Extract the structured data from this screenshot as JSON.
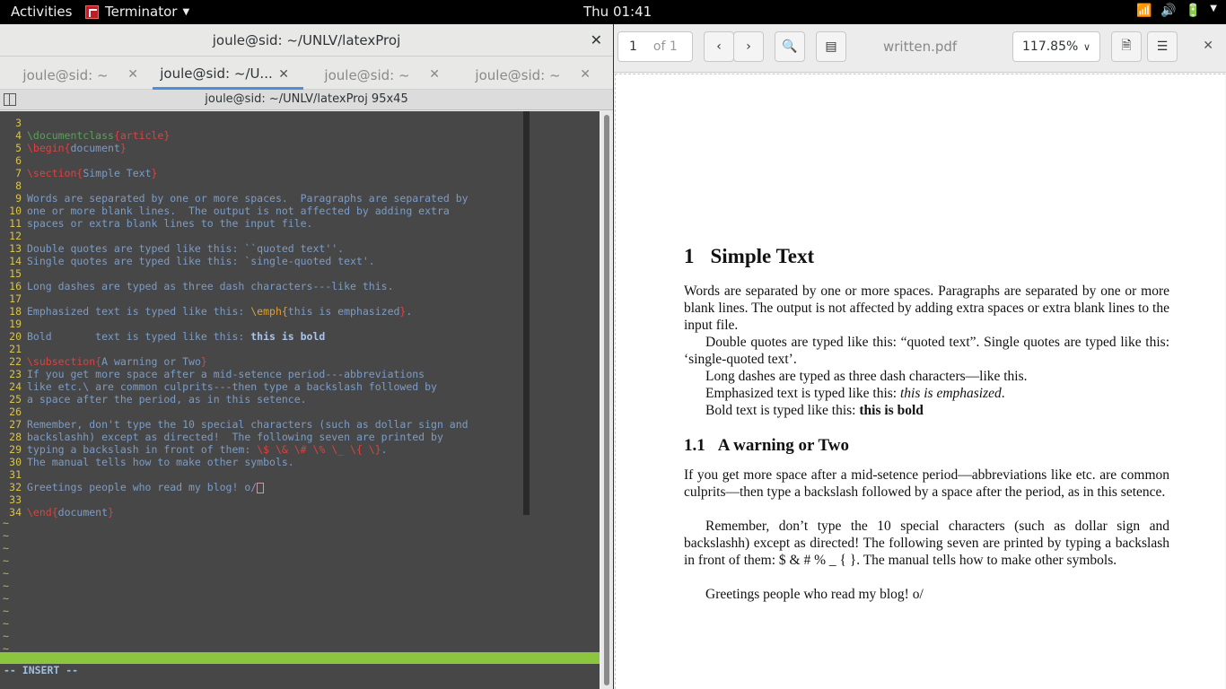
{
  "topbar": {
    "activities": "Activities",
    "app_name": "Terminator",
    "clock": "Thu 01:41",
    "icons": [
      "wifi-icon",
      "volume-icon",
      "battery-icon",
      "system-menu-caret"
    ]
  },
  "terminal": {
    "window_title": "joule@sid: ~/UNLV/latexProj",
    "tabs": [
      {
        "label": "joule@sid: ~",
        "active": false
      },
      {
        "label": "joule@sid: ~/U...",
        "active": true
      },
      {
        "label": "joule@sid: ~",
        "active": false
      },
      {
        "label": "joule@sid: ~",
        "active": false
      }
    ],
    "infobar": "joule@sid: ~/UNLV/latexProj 95x45",
    "vim_lines": [
      {
        "n": "3",
        "t": ""
      },
      {
        "n": "4",
        "t": "\\documentclass{article}"
      },
      {
        "n": "5",
        "t": "\\begin{document}"
      },
      {
        "n": "6",
        "t": ""
      },
      {
        "n": "7",
        "t": "\\section{Simple Text}"
      },
      {
        "n": "8",
        "t": ""
      },
      {
        "n": "9",
        "t": "Words are separated by one or more spaces.  Paragraphs are separated by"
      },
      {
        "n": "10",
        "t": "one or more blank lines.  The output is not affected by adding extra"
      },
      {
        "n": "11",
        "t": "spaces or extra blank lines to the input file."
      },
      {
        "n": "12",
        "t": ""
      },
      {
        "n": "13",
        "t": "Double quotes are typed like this: ``quoted text''."
      },
      {
        "n": "14",
        "t": "Single quotes are typed like this: `single-quoted text'."
      },
      {
        "n": "15",
        "t": ""
      },
      {
        "n": "16",
        "t": "Long dashes are typed as three dash characters---like this."
      },
      {
        "n": "17",
        "t": ""
      },
      {
        "n": "18",
        "t": "Emphasized text is typed like this: \\emph{this is emphasized}."
      },
      {
        "n": "19",
        "t": ""
      },
      {
        "n": "20",
        "t": "Bold       text is typed like this: this is bold"
      },
      {
        "n": "21",
        "t": ""
      },
      {
        "n": "22",
        "t": "\\subsection{A warning or Two}"
      },
      {
        "n": "23",
        "t": "If you get more space after a mid-setence period---abbreviations"
      },
      {
        "n": "24",
        "t": "like etc.\\ are common culprits---then type a backslash followed by"
      },
      {
        "n": "25",
        "t": "a space after the period, as in this setence."
      },
      {
        "n": "26",
        "t": ""
      },
      {
        "n": "27",
        "t": "Remember, don't type the 10 special characters (such as dollar sign and"
      },
      {
        "n": "28",
        "t": "backslashh) except as directed!  The following seven are printed by"
      },
      {
        "n": "29",
        "t": "typing a backslash in front of them: \\$ \\& \\# \\% \\_ \\{ \\}."
      },
      {
        "n": "30",
        "t": "The manual tells how to make other symbols."
      },
      {
        "n": "31",
        "t": ""
      },
      {
        "n": "32",
        "t": "Greetings people who read my blog! o/"
      },
      {
        "n": "33",
        "t": ""
      },
      {
        "n": "34",
        "t": "\\end{document}"
      }
    ],
    "mode": "-- INSERT --"
  },
  "pdf": {
    "page_current": "1",
    "page_of": "of 1",
    "doc_title": "written.pdf",
    "zoom": "117.85%",
    "section_num": "1",
    "section_title": "Simple Text",
    "para1": "Words are separated by one or more spaces. Paragraphs are separated by one or more blank lines. The output is not affected by adding extra spaces or extra blank lines to the input file.",
    "para2": "Double quotes are typed like this: “quoted text”. Single quotes are typed like this: ‘single-quoted text’.",
    "para3": "Long dashes are typed as three dash characters—like this.",
    "para4_prefix": "Emphasized text is typed like this: ",
    "para4_emph": "this is emphasized",
    "para4_suffix": ".",
    "para5_prefix": "Bold text is typed like this: ",
    "para5_bold": "this is bold",
    "subsection_num": "1.1",
    "subsection_title": "A warning or Two",
    "para6": "If you get more space after a mid-setence period—abbreviations like etc. are common culprits—then type a backslash followed by a space after the period, as in this setence.",
    "para7": "Remember, don’t type the 10 special characters (such as dollar sign and backslashh) except as directed! The following seven are printed by typing a backslash in front of them: $ & # % _ { }. The manual tells how to make other symbols.",
    "para8": "Greetings people who read my blog! o/"
  }
}
